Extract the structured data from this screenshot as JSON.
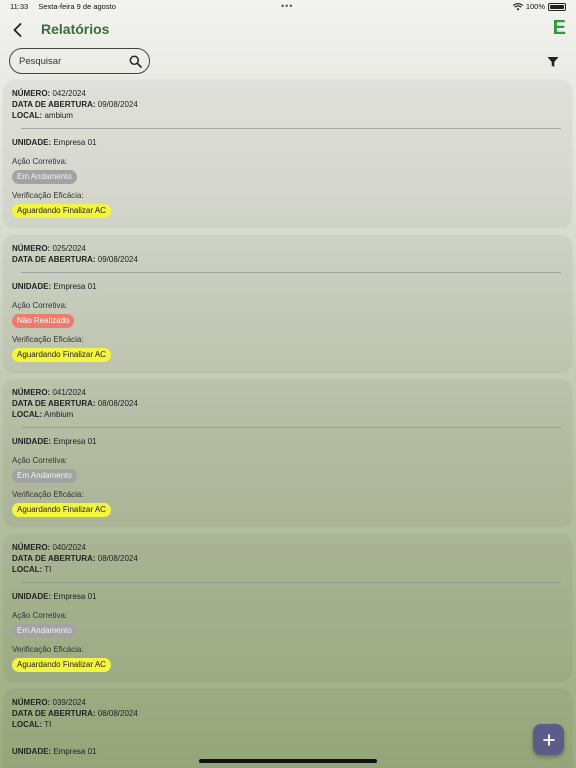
{
  "status_bar": {
    "time": "11:33",
    "date": "Sexta-feira 9 de agosto",
    "battery": "100%"
  },
  "header": {
    "title": "Relatórios",
    "logo": "E"
  },
  "search": {
    "placeholder": "Pesquisar"
  },
  "labels": {
    "numero": "NÚMERO:",
    "data_abertura": "DATA DE ABERTURA:",
    "local": "LOCAL:",
    "unidade": "UNIDADE:",
    "acao_corretiva": "Ação Corretiva:",
    "verificacao": "Verificação Eficácia:"
  },
  "reports": [
    {
      "numero": "042/2024",
      "data": "09/08/2024",
      "local": "ambium",
      "unidade": "Empresa 01",
      "acao": "Em Andamento",
      "acao_status": "gray",
      "verificacao": "Aguardando Finalizar AC"
    },
    {
      "numero": "025/2024",
      "data": "09/08/2024",
      "local": null,
      "unidade": "Empresa 01",
      "acao": "Não Realizado",
      "acao_status": "red",
      "verificacao": "Aguardando Finalizar AC"
    },
    {
      "numero": "041/2024",
      "data": "08/08/2024",
      "local": "Ambium",
      "unidade": "Empresa 01",
      "acao": "Em Andamento",
      "acao_status": "gray",
      "verificacao": "Aguardando Finalizar AC"
    },
    {
      "numero": "040/2024",
      "data": "08/08/2024",
      "local": "TI",
      "unidade": "Empresa 01",
      "acao": "Em Andamento",
      "acao_status": "gray",
      "verificacao": "Aguardando Finalizar AC"
    },
    {
      "numero": "039/2024",
      "data": "08/08/2024",
      "local": "TI",
      "unidade": "Empresa 01",
      "acao": null,
      "acao_status": null,
      "verificacao": null
    }
  ],
  "fab": {
    "icon": "plus-icon"
  },
  "colors": {
    "title_green": "#3d6b3a",
    "logo_green": "#2e9a3a",
    "fab": "#5b5d88",
    "badge_gray": "#a3a3a3",
    "badge_red": "#f07b6d",
    "badge_yellow": "#f4f53f"
  }
}
